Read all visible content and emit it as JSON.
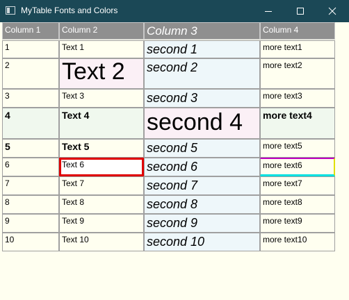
{
  "window": {
    "title": "MyTable Fonts and Colors"
  },
  "table": {
    "headers": [
      "Column 1",
      "Column 2",
      "Column 3",
      "Column 4"
    ],
    "rows": [
      [
        "1",
        "Text 1",
        "second 1",
        "more text1"
      ],
      [
        "2",
        "Text 2",
        "second 2",
        "more text2"
      ],
      [
        "3",
        "Text 3",
        "second 3",
        "more text3"
      ],
      [
        "4",
        "Text 4",
        "second 4",
        "more text4"
      ],
      [
        "5",
        "Text 5",
        "second 5",
        "more text5"
      ],
      [
        "6",
        "Text 6",
        "second 6",
        "more text6"
      ],
      [
        "7",
        "Text 7",
        "second 7",
        "more text7"
      ],
      [
        "8",
        "Text 8",
        "second 8",
        "more text8"
      ],
      [
        "9",
        "Text 9",
        "second 9",
        "more text9"
      ],
      [
        "10",
        "Text 10",
        "second 10",
        "more text10"
      ]
    ]
  },
  "colors": {
    "titlebar": "#1b4856",
    "window_background": "#fffff0",
    "header_background": "#8f8f8f",
    "selected_cell_border": "#e00000",
    "col3_background": "#eef7fa",
    "highlight_pink": "#fbf0f6",
    "row4_background": "#f0f8ee",
    "frame_magenta": "#c000c0",
    "frame_yellow": "#e0e000",
    "frame_cyan": "#00e0e0"
  }
}
